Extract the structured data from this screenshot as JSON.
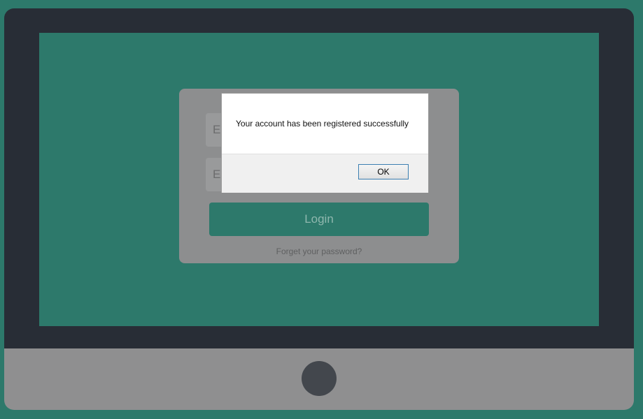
{
  "login_form": {
    "email_field_text": "E",
    "second_field_text": "En",
    "login_button_label": "Login",
    "forgot_password_link": "Forget your password?"
  },
  "alert": {
    "message": "Your account has been registered successfully",
    "ok_label": "OK"
  },
  "colors": {
    "background": "#2d796b",
    "monitor_frame": "#282d36",
    "monitor_chin": "#8f8f90",
    "card": "#8d8e8f",
    "accent": "#2d796b"
  }
}
